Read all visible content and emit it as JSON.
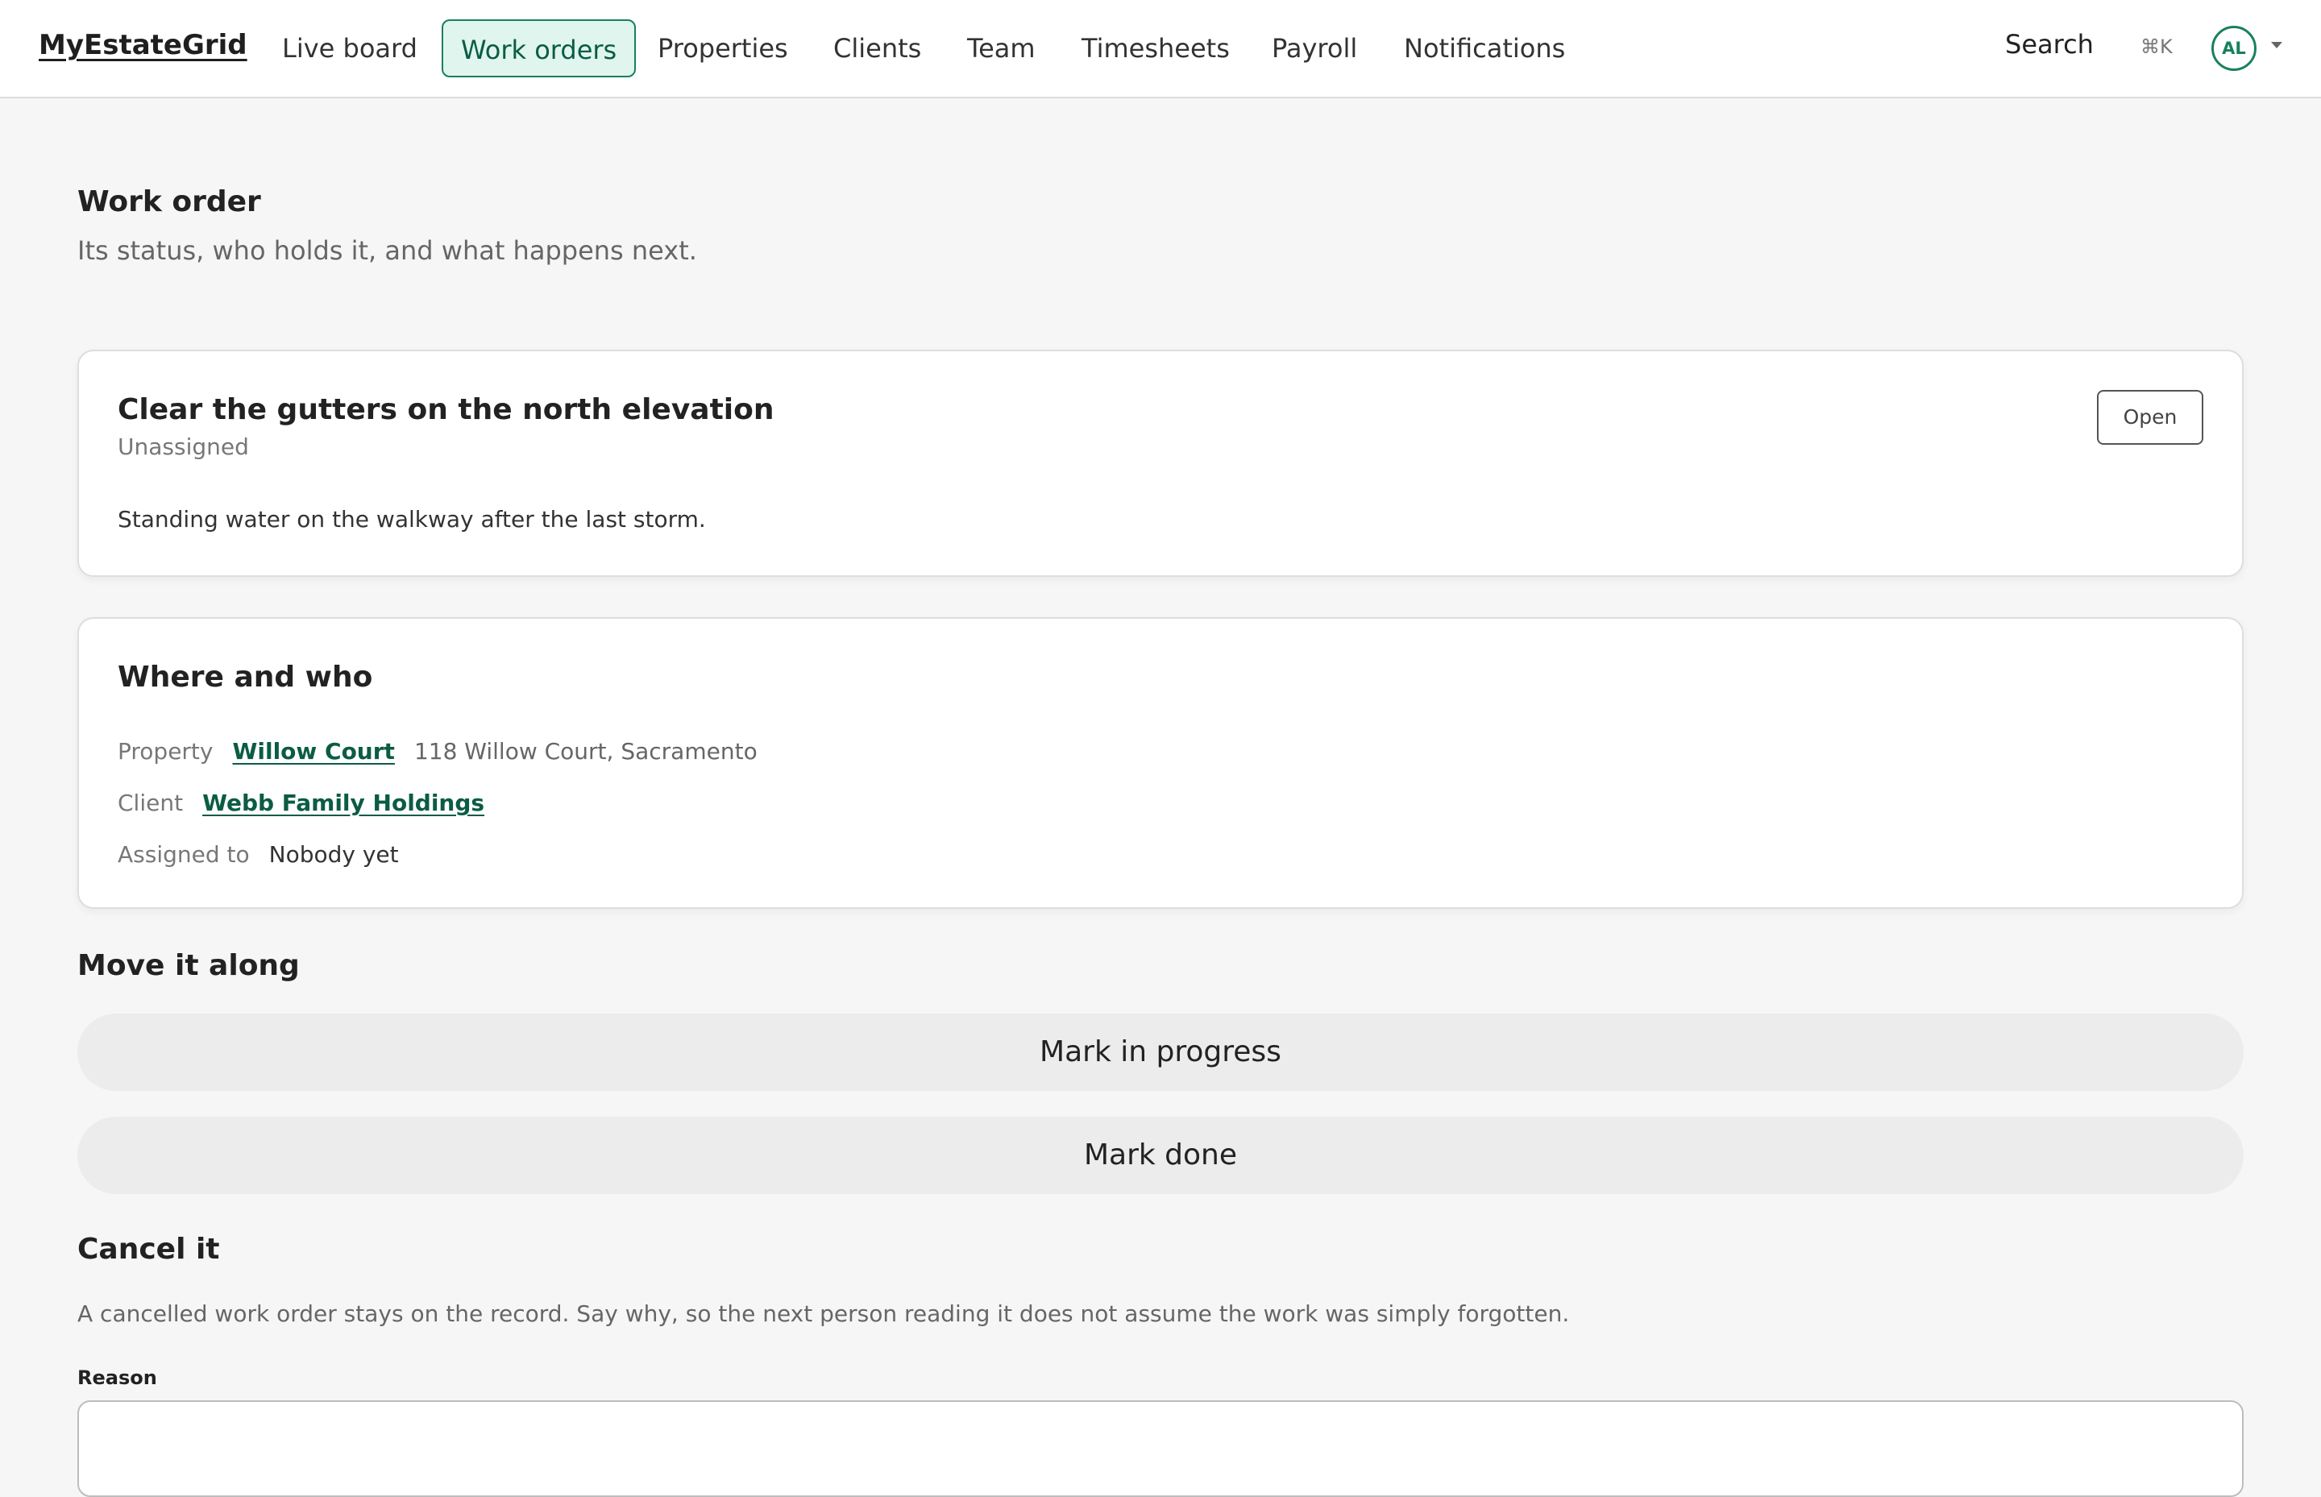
{
  "header": {
    "brand": "MyEstateGrid",
    "nav": [
      "Live board",
      "Work orders",
      "Properties",
      "Clients",
      "Team",
      "Timesheets",
      "Payroll",
      "Notifications"
    ],
    "active_nav": "Work orders",
    "search_label": "Search",
    "search_shortcut": "⌘K",
    "avatar_initials": "AL"
  },
  "page": {
    "title": "Work order",
    "subtitle": "Its status, who holds it, and what happens next."
  },
  "work_order": {
    "title": "Clear the gutters on the north elevation",
    "assignee_status": "Unassigned",
    "description": "Standing water on the walkway after the last storm.",
    "status": "Open"
  },
  "details": {
    "title": "Where and who",
    "property_label": "Property",
    "property_name": "Willow Court",
    "property_address": "118 Willow Court, Sacramento",
    "client_label": "Client",
    "client_name": "Webb Family Holdings",
    "assigned_label": "Assigned to",
    "assigned_value": "Nobody yet"
  },
  "actions": {
    "title": "Move it along",
    "in_progress": "Mark in progress",
    "done": "Mark done"
  },
  "cancel": {
    "title": "Cancel it",
    "note": "A cancelled work order stays on the record. Say why, so the next person reading it does not assume the work was simply forgotten.",
    "reason_label": "Reason"
  },
  "colors": {
    "accent": "#17805f",
    "accent_bg": "#dff5ee",
    "page_bg": "#f6f6f6"
  }
}
